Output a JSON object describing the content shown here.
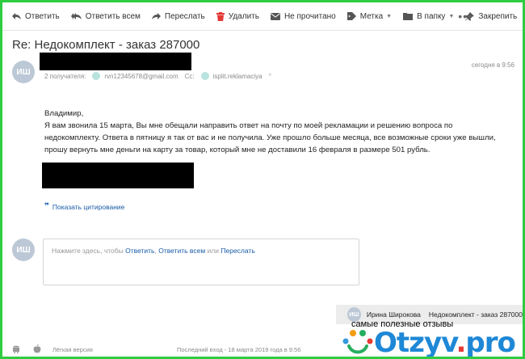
{
  "toolbar": {
    "reply": "Ответить",
    "reply_all": "Ответить всем",
    "forward": "Переслать",
    "delete": "Удалить",
    "unread": "Не прочитано",
    "label": "Метка",
    "folder": "В папку",
    "pin": "Закрепить",
    "more": "•••"
  },
  "message": {
    "subject": "Re: Недокомплект - заказ 287000",
    "avatar_initials": "ИШ",
    "recipients_label": "2 получателя:",
    "recipient_1": "rvn12345678@gmail.com",
    "cc_label": "Cc:",
    "recipient_2": "isplit.reklamaciya",
    "date": "сегодня в 9:56",
    "body": [
      "Владимир,",
      "Я вам звонила 15 марта, Вы мне обещали направить ответ на почту по моей рекламации и решению вопроса по",
      "недокомплекту. Ответа в пятницу я так от вас и не получила. Уже прошло больше месяца, все возможные сроки уже вышли,",
      "прошу вернуть мне деньги на карту за товар, который мне не доставили 16 февраля в размере 501 рубль."
    ],
    "show_quote": "Показать цитирование"
  },
  "reply": {
    "avatar_initials": "ИШ",
    "hint_prefix": "Нажмите здесь, чтобы",
    "reply_link": "Ответить",
    "comma": ",",
    "reply_all_link": "Ответить всем",
    "or": "или",
    "forward_link": "Переслать"
  },
  "notification": {
    "avatar_initials": "ИШ",
    "sender": "Ирина Широкова",
    "subject": "Недокомплект - заказ 287000"
  },
  "watermark": {
    "tagline": "самые полезные отзывы",
    "logo_main": "Otzyv",
    "logo_dot": ".",
    "logo_tld": "pro"
  },
  "footer": {
    "lite": "Лёгкая версия",
    "last_login": "Последний вход - 18 марта 2019 года в 9:56"
  },
  "colors": {
    "link": "#1a5ba8",
    "avatar": "#bcc8d6",
    "delete_icon": "#e53935",
    "frame": "#2ecc40"
  }
}
